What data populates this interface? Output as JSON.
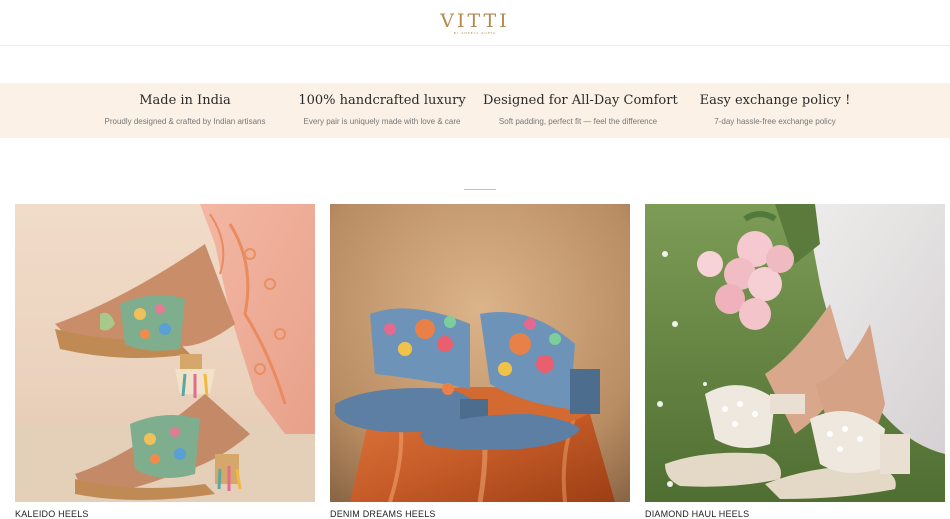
{
  "header": {
    "logo_text": "VITTI",
    "logo_tagline": "BY SHREYA GUPTA"
  },
  "features": [
    {
      "title": "Made in India",
      "description": "Proudly designed & crafted by Indian artisans"
    },
    {
      "title": "100% handcrafted luxury",
      "description": "Every pair is uniquely made with love & care"
    },
    {
      "title": "Designed for All-Day Comfort",
      "description": "Soft padding, perfect fit — feel the difference"
    },
    {
      "title": "Easy exchange policy !",
      "description": "7-day hassle-free exchange policy"
    }
  ],
  "products": [
    {
      "name": "KALEIDO HEELS",
      "image": "kaleido-heels-photo"
    },
    {
      "name": "DENIM DREAMS HEELS",
      "image": "denim-dreams-heels-photo"
    },
    {
      "name": "DIAMOND HAUL HEELS",
      "image": "diamond-haul-heels-photo"
    }
  ]
}
